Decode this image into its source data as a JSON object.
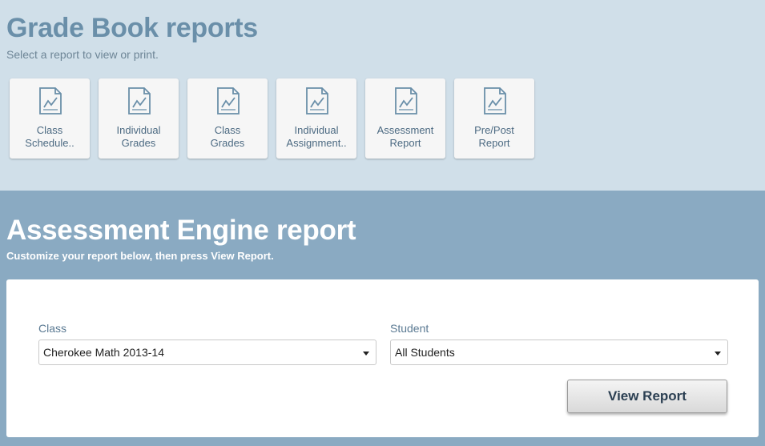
{
  "gradebook": {
    "title": "Grade Book reports",
    "subtitle": "Select a report to view or print.",
    "reports": [
      {
        "label": "Class\nSchedule..",
        "icon": "chart-document-icon"
      },
      {
        "label": "Individual\nGrades",
        "icon": "chart-document-icon"
      },
      {
        "label": "Class\nGrades",
        "icon": "chart-document-icon"
      },
      {
        "label": "Individual\nAssignment..",
        "icon": "chart-document-icon"
      },
      {
        "label": "Assessment\nReport",
        "icon": "chart-document-icon"
      },
      {
        "label": "Pre/Post\nReport",
        "icon": "chart-document-icon"
      }
    ]
  },
  "assessment": {
    "title": "Assessment Engine report",
    "subtitle": "Customize your report below, then press View Report.",
    "class_field": {
      "label": "Class",
      "value": "Cherokee Math 2013-14"
    },
    "student_field": {
      "label": "Student",
      "value": "All Students"
    },
    "view_button_label": "View Report"
  },
  "colors": {
    "top_background": "#d0dfe9",
    "bottom_background": "#8aaac2",
    "title_blue": "#6a8fa9",
    "icon_stroke": "#6a8fa9"
  }
}
